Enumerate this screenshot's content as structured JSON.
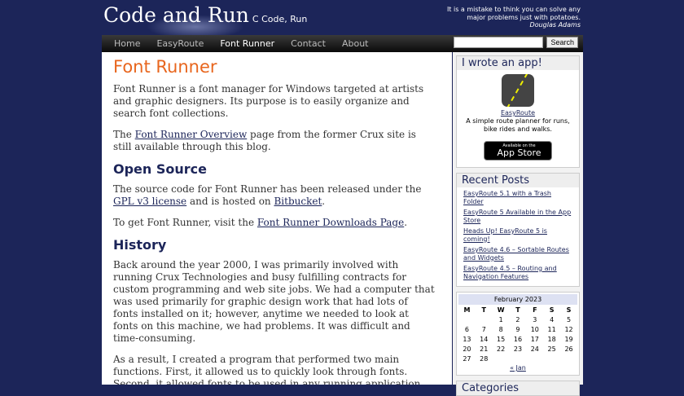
{
  "header": {
    "title": "Code and Run",
    "tagline": "C Code, Run",
    "quote": "It is a mistake to think you can solve any major problems just with potatoes.",
    "quote_author": "Douglas Adams"
  },
  "nav": {
    "items": [
      "Home",
      "EasyRoute",
      "Font Runner",
      "Contact",
      "About"
    ],
    "search_button": "Search"
  },
  "main": {
    "title": "Font Runner",
    "p1": "Font Runner is a font manager for Windows targeted at artists and graphic designers. Its purpose is to easily organize and search font collections.",
    "p2_pre": "The ",
    "p2_link": "Font Runner Overview",
    "p2_post": " page from the former Crux site is still available through this blog.",
    "h_open": "Open Source",
    "p3_pre": "The source code for Font Runner has been released under the ",
    "p3_link1": "GPL v3 license",
    "p3_mid": " and is hosted on ",
    "p3_link2": "Bitbucket",
    "p3_post": ".",
    "p4_pre": "To get Font Runner, visit the ",
    "p4_link": "Font Runner Downloads Page",
    "p4_post": ".",
    "h_history": "History",
    "p5": "Back around the year 2000, I was primarily involved with running Crux Technologies and busy fulfilling contracts for custom programming and web site jobs.  We had a computer that was used primarily for graphic design work that had lots of fonts installed on it; however, anytime we needed to look at fonts on this machine, we had problems.  It was difficult and time-consuming.",
    "p6": "As a result, I created a program that performed two main functions. First, it allowed us to quickly look through fonts.  Second, it allowed fonts to be used in any running application even if they were not"
  },
  "sidebar": {
    "app_title": "I wrote an app!",
    "app_name": "EasyRoute",
    "app_desc": "A simple route planner for runs, bike rides and walks.",
    "store_small": "Available on the",
    "store_big": "App Store",
    "recent_title": "Recent Posts",
    "posts": [
      "EasyRoute 5.1 with a Trash Folder",
      "EasyRoute 5 Available in the App Store",
      "Heads Up! EasyRoute 5 is coming!",
      "EasyRoute 4.6 – Sortable Routes and Widgets",
      "EasyRoute 4.5 – Routing and Navigation Features"
    ],
    "calendar": {
      "caption": "February 2023",
      "days": [
        "M",
        "T",
        "W",
        "T",
        "F",
        "S",
        "S"
      ],
      "weeks": [
        [
          "",
          "",
          "1",
          "2",
          "3",
          "4",
          "5"
        ],
        [
          "6",
          "7",
          "8",
          "9",
          "10",
          "11",
          "12"
        ],
        [
          "13",
          "14",
          "15",
          "16",
          "17",
          "18",
          "19"
        ],
        [
          "20",
          "21",
          "22",
          "23",
          "24",
          "25",
          "26"
        ],
        [
          "27",
          "28",
          "",
          "",
          "",
          "",
          ""
        ]
      ],
      "prev": "« Jan"
    },
    "categories_title": "Categories"
  }
}
